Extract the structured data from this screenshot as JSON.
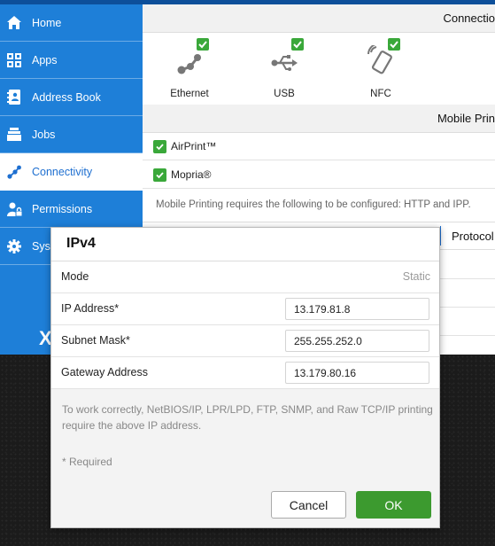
{
  "sidebar": {
    "items": [
      {
        "label": "Home",
        "icon": "home-icon"
      },
      {
        "label": "Apps",
        "icon": "apps-grid-icon"
      },
      {
        "label": "Address Book",
        "icon": "address-book-icon"
      },
      {
        "label": "Jobs",
        "icon": "jobs-stack-icon"
      },
      {
        "label": "Connectivity",
        "icon": "connectivity-icon",
        "active": true
      },
      {
        "label": "Permissions",
        "icon": "permissions-user-lock-icon"
      },
      {
        "label": "Syst",
        "icon": "gear-icon"
      }
    ],
    "logo": "X"
  },
  "main": {
    "section_connections": "Connectio",
    "tiles": [
      {
        "label": "Ethernet",
        "icon": "ethernet-icon",
        "checked": true
      },
      {
        "label": "USB",
        "icon": "usb-icon",
        "checked": true
      },
      {
        "label": "NFC",
        "icon": "nfc-icon",
        "checked": true
      }
    ],
    "section_mobile": "Mobile Prin",
    "mobile_options": [
      {
        "label": "AirPrint™",
        "checked": true
      },
      {
        "label": "Mopria®",
        "checked": true
      }
    ],
    "mobile_note": "Mobile Printing requires the following to be configured: HTTP and IPP.",
    "section_protocols": "Protocol"
  },
  "dialog": {
    "title": "IPv4",
    "mode_label": "Mode",
    "mode_value": "Static",
    "ip_label": "IP Address*",
    "ip_value": "13.179.81.8",
    "subnet_label": "Subnet Mask*",
    "subnet_value": "255.255.252.0",
    "gateway_label": "Gateway Address",
    "gateway_value": "13.179.80.16",
    "note": "To work correctly, NetBIOS/IP, LPR/LPD, FTP, SNMP, and Raw TCP/IP printing require the above IP address.",
    "required": "* Required",
    "cancel_label": "Cancel",
    "ok_label": "OK"
  },
  "colors": {
    "sidebar": "#1e7fd8",
    "topbar": "#0d4f9a",
    "check_green": "#3aa83a",
    "ok_green": "#3c9a2f"
  }
}
